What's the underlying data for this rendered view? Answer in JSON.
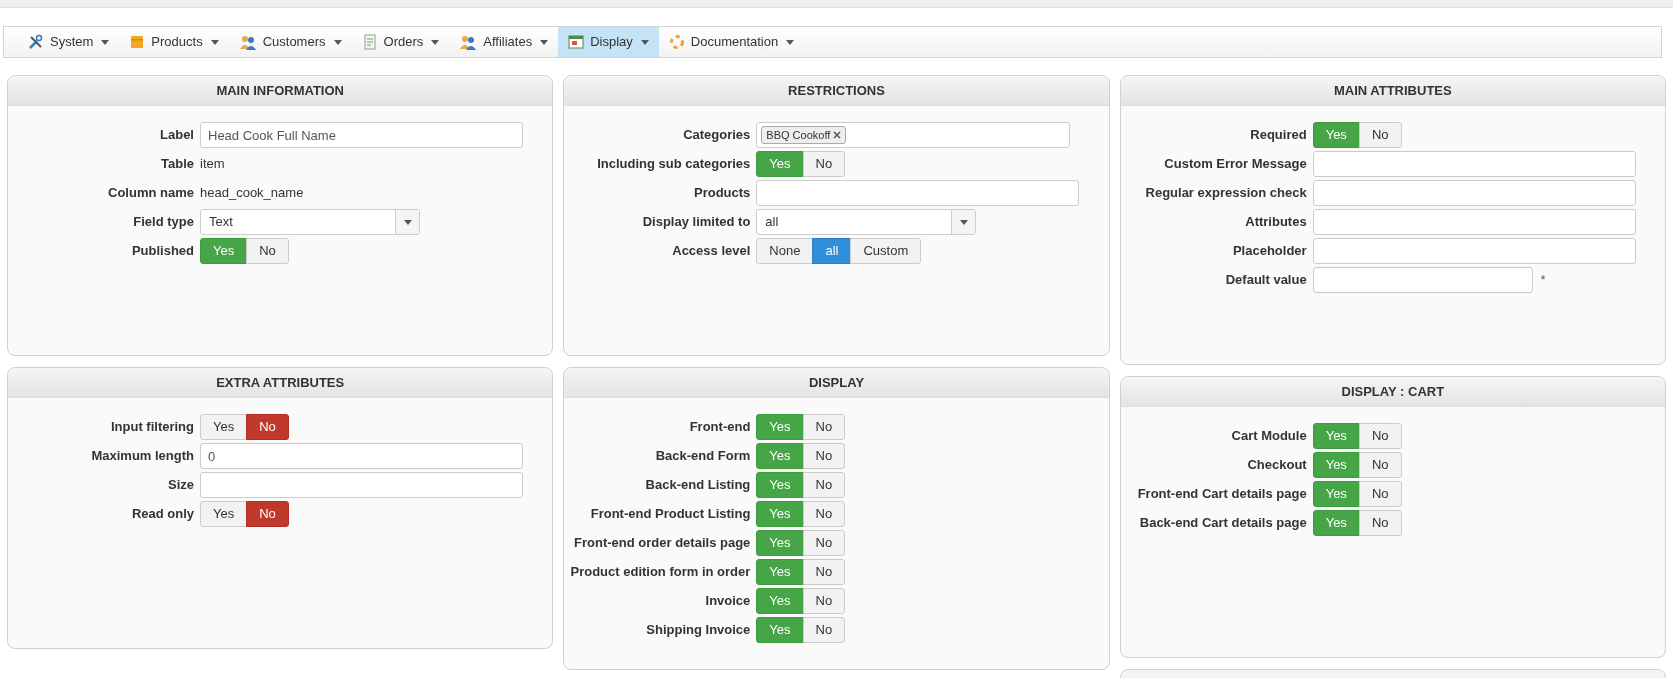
{
  "menu": [
    {
      "label": "System",
      "selected": false
    },
    {
      "label": "Products",
      "selected": false
    },
    {
      "label": "Customers",
      "selected": false
    },
    {
      "label": "Orders",
      "selected": false
    },
    {
      "label": "Affiliates",
      "selected": false
    },
    {
      "label": "Display",
      "selected": true
    },
    {
      "label": "Documentation",
      "selected": false
    }
  ],
  "columns": [
    {
      "panels": [
        {
          "title": "MAIN INFORMATION",
          "fields": [
            {
              "kind": "text",
              "label": "Label",
              "value": "Head Cook Full Name"
            },
            {
              "kind": "static",
              "label": "Table",
              "value": "item"
            },
            {
              "kind": "static",
              "label": "Column name",
              "value": "head_cook_name"
            },
            {
              "kind": "select",
              "label": "Field type",
              "value": "Text"
            },
            {
              "kind": "toggle",
              "label": "Published",
              "options": [
                {
                  "label": "Yes",
                  "selected": true
                },
                {
                  "label": "No",
                  "selected": false
                }
              ]
            }
          ]
        },
        {
          "title": "EXTRA ATTRIBUTES",
          "fields": [
            {
              "kind": "toggle",
              "label": "Input filtering",
              "options": [
                {
                  "label": "Yes",
                  "selected": false
                },
                {
                  "label": "No",
                  "selected": true
                }
              ]
            },
            {
              "kind": "text",
              "label": "Maximum length",
              "value": "0"
            },
            {
              "kind": "text",
              "label": "Size"
            },
            {
              "kind": "toggle",
              "label": "Read only",
              "options": [
                {
                  "label": "Yes",
                  "selected": false
                },
                {
                  "label": "No",
                  "selected": true
                }
              ]
            }
          ]
        }
      ]
    },
    {
      "panels": [
        {
          "title": "RESTRICTIONS",
          "fields": [
            {
              "kind": "tags",
              "label": "Categories",
              "tags": [
                "BBQ Cookoff"
              ]
            },
            {
              "kind": "toggle",
              "label": "Including sub categories",
              "options": [
                {
                  "label": "Yes",
                  "selected": true
                },
                {
                  "label": "No",
                  "selected": false
                }
              ]
            },
            {
              "kind": "text",
              "label": "Products"
            },
            {
              "kind": "select",
              "label": "Display limited to",
              "value": "all"
            },
            {
              "kind": "choice",
              "label": "Access level",
              "options": [
                {
                  "label": "None",
                  "selected": false
                },
                {
                  "label": "all",
                  "selected": true
                },
                {
                  "label": "Custom",
                  "selected": false
                }
              ]
            }
          ]
        },
        {
          "title": "DISPLAY",
          "fields": [
            {
              "kind": "toggle",
              "label": "Front-end",
              "options": [
                {
                  "label": "Yes",
                  "selected": true
                },
                {
                  "label": "No",
                  "selected": false
                }
              ]
            },
            {
              "kind": "toggle",
              "label": "Back-end Form",
              "options": [
                {
                  "label": "Yes",
                  "selected": true
                },
                {
                  "label": "No",
                  "selected": false
                }
              ]
            },
            {
              "kind": "toggle",
              "label": "Back-end Listing",
              "options": [
                {
                  "label": "Yes",
                  "selected": true
                },
                {
                  "label": "No",
                  "selected": false
                }
              ]
            },
            {
              "kind": "toggle",
              "label": "Front-end Product Listing",
              "options": [
                {
                  "label": "Yes",
                  "selected": true
                },
                {
                  "label": "No",
                  "selected": false
                }
              ]
            },
            {
              "kind": "toggle",
              "label": "Front-end order details page",
              "options": [
                {
                  "label": "Yes",
                  "selected": true
                },
                {
                  "label": "No",
                  "selected": false
                }
              ]
            },
            {
              "kind": "toggle",
              "label": "Product edition form in order",
              "options": [
                {
                  "label": "Yes",
                  "selected": true
                },
                {
                  "label": "No",
                  "selected": false
                }
              ]
            },
            {
              "kind": "toggle",
              "label": "Invoice",
              "options": [
                {
                  "label": "Yes",
                  "selected": true
                },
                {
                  "label": "No",
                  "selected": false
                }
              ]
            },
            {
              "kind": "toggle",
              "label": "Shipping Invoice",
              "options": [
                {
                  "label": "Yes",
                  "selected": true
                },
                {
                  "label": "No",
                  "selected": false
                }
              ]
            }
          ]
        }
      ]
    },
    {
      "panels": [
        {
          "title": "MAIN ATTRIBUTES",
          "fields": [
            {
              "kind": "toggle",
              "label": "Required",
              "options": [
                {
                  "label": "Yes",
                  "selected": true
                },
                {
                  "label": "No",
                  "selected": false
                }
              ]
            },
            {
              "kind": "text",
              "label": "Custom Error Message"
            },
            {
              "kind": "text",
              "label": "Regular expression check"
            },
            {
              "kind": "text",
              "label": "Attributes"
            },
            {
              "kind": "text",
              "label": "Placeholder"
            },
            {
              "kind": "short_text",
              "label": "Default value",
              "note": "*"
            }
          ]
        },
        {
          "title": "DISPLAY : CART",
          "fields": [
            {
              "kind": "toggle",
              "label": "Cart Module",
              "options": [
                {
                  "label": "Yes",
                  "selected": true
                },
                {
                  "label": "No",
                  "selected": false
                }
              ]
            },
            {
              "kind": "toggle",
              "label": "Checkout",
              "options": [
                {
                  "label": "Yes",
                  "selected": true
                },
                {
                  "label": "No",
                  "selected": false
                }
              ]
            },
            {
              "kind": "toggle",
              "label": "Front-end Cart details page",
              "options": [
                {
                  "label": "Yes",
                  "selected": true
                },
                {
                  "label": "No",
                  "selected": false
                }
              ]
            },
            {
              "kind": "toggle",
              "label": "Back-end Cart details page",
              "options": [
                {
                  "label": "Yes",
                  "selected": true
                },
                {
                  "label": "No",
                  "selected": false
                }
              ]
            }
          ]
        },
        {
          "kind": "cut_off"
        }
      ]
    }
  ]
}
